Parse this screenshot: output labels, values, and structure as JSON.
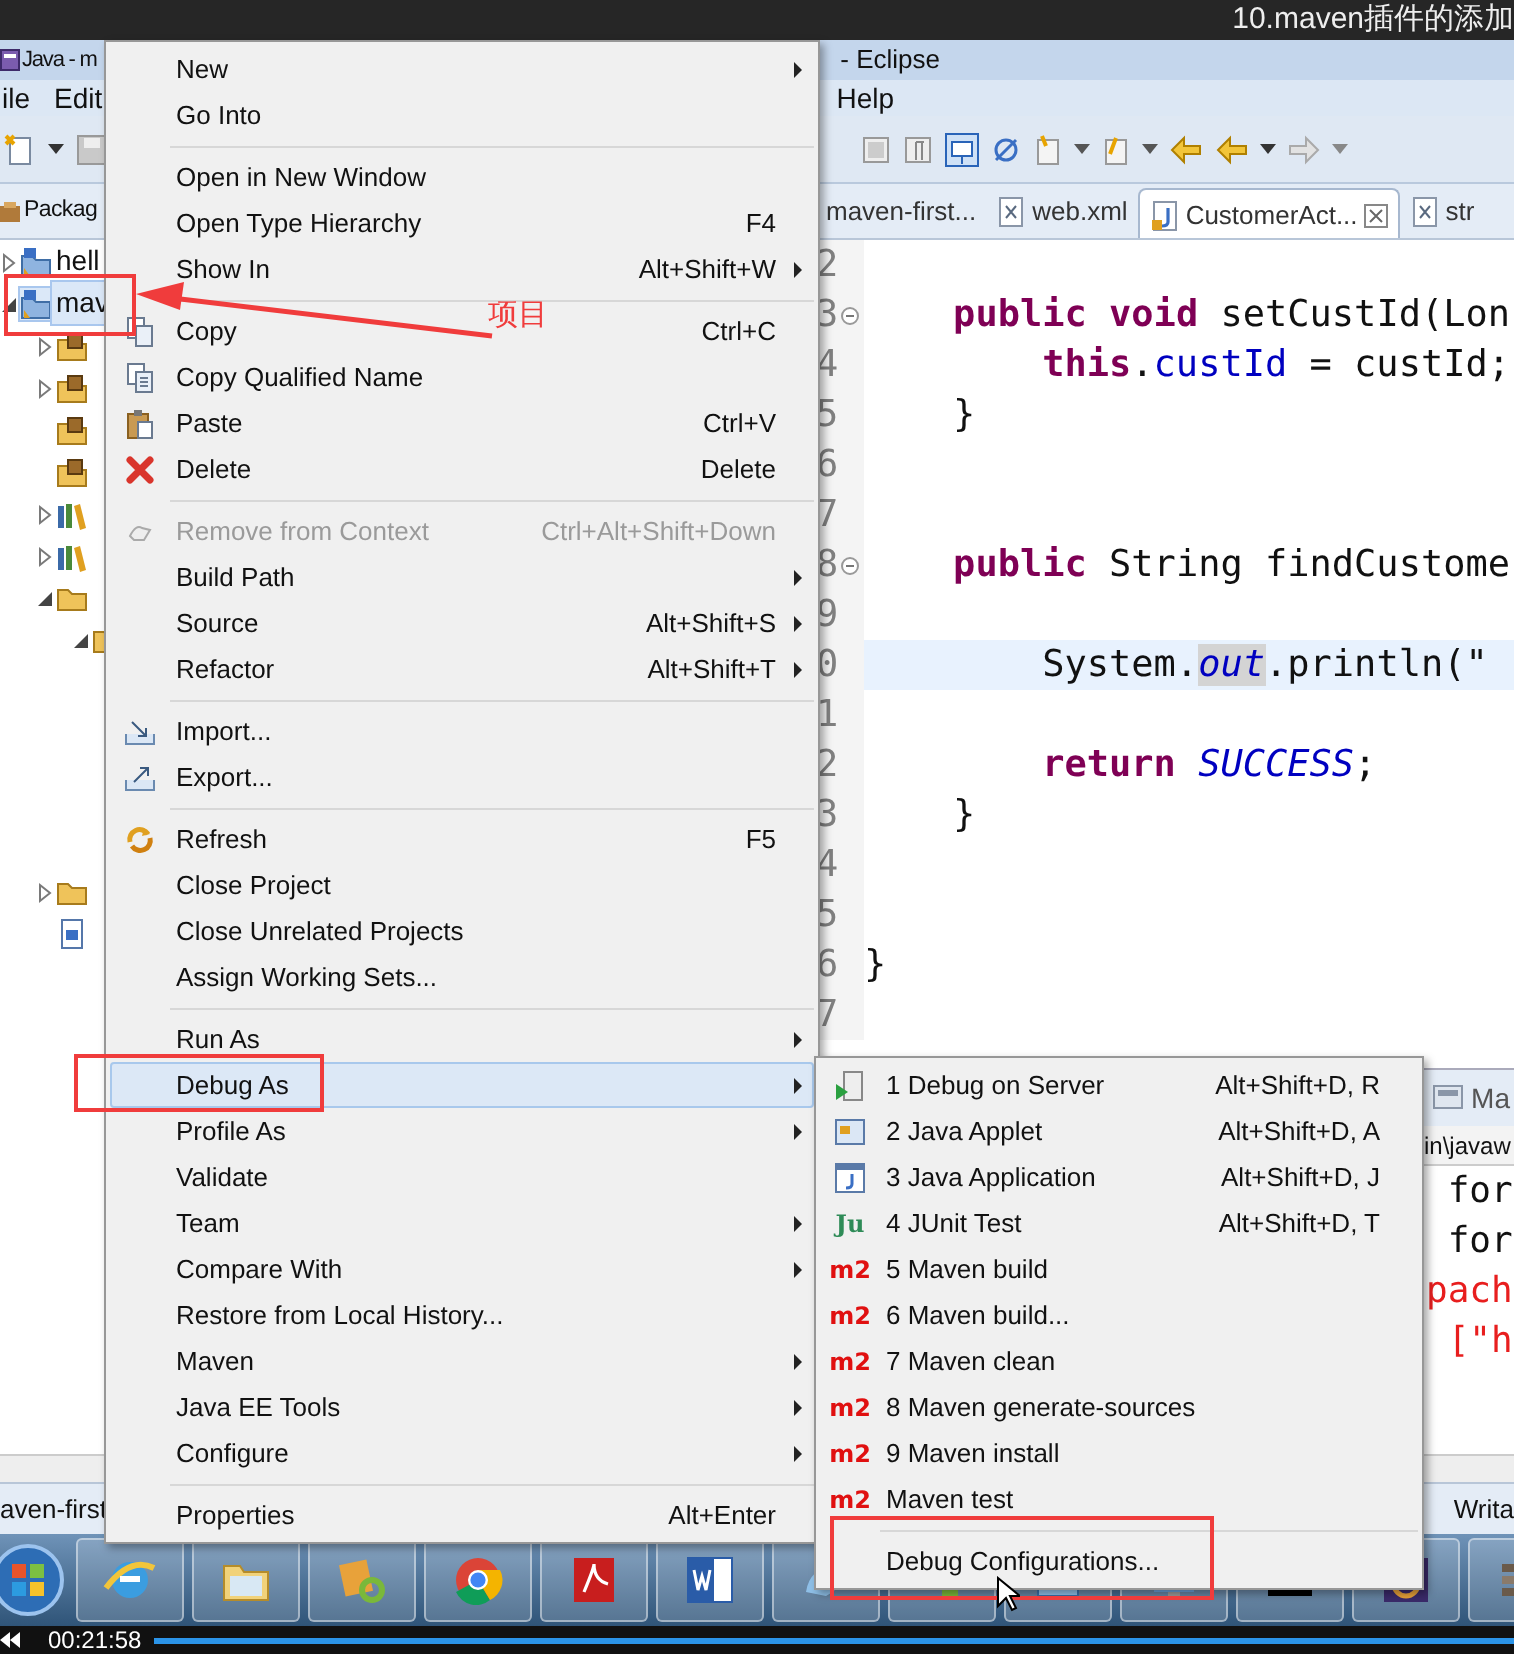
{
  "video_title": "10.maven插件的添加",
  "window": {
    "title": "Java - m",
    "title_suffix": "- Eclipse"
  },
  "menu_bar": [
    "ile",
    "Edit",
    "Help"
  ],
  "package_explorer": {
    "tab": "Packag",
    "tree": [
      {
        "label": "hell",
        "kind": "project",
        "expanded": false,
        "selected": false
      },
      {
        "label": "mav",
        "kind": "project",
        "expanded": true,
        "selected": true,
        "children": [
          {
            "kind": "package",
            "expanded": false,
            "selected": false
          },
          {
            "kind": "package",
            "expanded": false,
            "selected": false
          },
          {
            "kind": "package",
            "selected": false
          },
          {
            "kind": "package",
            "selected": false
          },
          {
            "kind": "library",
            "expanded": false,
            "selected": false
          },
          {
            "kind": "library",
            "expanded": false,
            "selected": false
          },
          {
            "kind": "folder",
            "expanded": true,
            "selected": false,
            "children": [
              {
                "kind": "folder",
                "expanded": true,
                "selected": false
              }
            ]
          },
          {
            "kind": "folder",
            "expanded": false,
            "selected": false
          },
          {
            "kind": "file",
            "selected": false
          }
        ]
      }
    ]
  },
  "editor": {
    "tabs": [
      {
        "label": "maven-first...",
        "kind": "plain",
        "selected": false
      },
      {
        "label": "web.xml",
        "kind": "xml",
        "selected": false
      },
      {
        "label": "CustomerAct...",
        "kind": "java",
        "selected": true
      },
      {
        "label": "str",
        "kind": "xml",
        "selected": false
      }
    ],
    "lines": [
      {
        "number": "2",
        "current": false,
        "foldable": false
      },
      {
        "number": "3",
        "current": false,
        "foldable": true,
        "tokens": [
          {
            "text": "    public",
            "kind": "keyword"
          },
          {
            "text": " void",
            "kind": "keyword"
          },
          {
            "text": " setCustId(Lon",
            "kind": "plain"
          }
        ]
      },
      {
        "number": "4",
        "current": false,
        "foldable": false,
        "tokens": [
          {
            "text": "        this",
            "kind": "keyword"
          },
          {
            "text": ".",
            "kind": "plain"
          },
          {
            "text": "custId",
            "kind": "field"
          },
          {
            "text": " = custId;",
            "kind": "plain"
          }
        ]
      },
      {
        "number": "5",
        "current": false,
        "foldable": false,
        "tokens": [
          {
            "text": "    }",
            "kind": "plain"
          }
        ]
      },
      {
        "number": "6",
        "current": false,
        "foldable": false
      },
      {
        "number": "7",
        "current": false,
        "foldable": false
      },
      {
        "number": "8",
        "current": false,
        "foldable": true,
        "tokens": [
          {
            "text": "    public",
            "kind": "keyword"
          },
          {
            "text": " String findCustome",
            "kind": "plain"
          }
        ]
      },
      {
        "number": "9",
        "current": false,
        "foldable": false
      },
      {
        "number": "0",
        "current": true,
        "foldable": false,
        "tokens": [
          {
            "text": "        System.",
            "kind": "plain"
          },
          {
            "text": "out",
            "kind": "static_mark"
          },
          {
            "text": ".println(\"",
            "kind": "plain"
          }
        ]
      },
      {
        "number": "1",
        "current": false,
        "foldable": false
      },
      {
        "number": "2",
        "current": false,
        "foldable": false,
        "tokens": [
          {
            "text": "        return",
            "kind": "keyword"
          },
          {
            "text": " SUCCESS",
            "kind": "static"
          },
          {
            "text": ";",
            "kind": "plain"
          }
        ]
      },
      {
        "number": "3",
        "current": false,
        "foldable": false,
        "tokens": [
          {
            "text": "    }",
            "kind": "plain"
          }
        ]
      },
      {
        "number": "4",
        "current": false,
        "foldable": false
      },
      {
        "number": "5",
        "current": false,
        "foldable": false
      },
      {
        "number": "6",
        "current": false,
        "foldable": false,
        "tokens": [
          {
            "text": "}",
            "kind": "plain"
          }
        ]
      },
      {
        "number": "7",
        "current": false,
        "foldable": false
      }
    ]
  },
  "console": {
    "tab": "Ma",
    "path": "in\\javaw",
    "lines": [
      {
        "text": " for",
        "kind": "plain"
      },
      {
        "text": " for",
        "kind": "plain"
      },
      {
        "text": "pach",
        "kind": "error"
      },
      {
        "text": " [\"h",
        "kind": "error"
      }
    ]
  },
  "bottom_tabs": {
    "left": "aven-first",
    "right": "Writa"
  },
  "context_menu": {
    "items": [
      {
        "kind": "plain",
        "label": "New",
        "submenu": true,
        "selected": false,
        "disabled": false
      },
      {
        "kind": "plain",
        "label": "Go Into",
        "submenu": false,
        "selected": false,
        "disabled": false
      },
      {
        "kind": "separator"
      },
      {
        "kind": "plain",
        "label": "Open in New Window",
        "submenu": false,
        "selected": false,
        "disabled": false
      },
      {
        "kind": "plain",
        "label": "Open Type Hierarchy",
        "shortcut": "F4",
        "submenu": false,
        "selected": false,
        "disabled": false
      },
      {
        "kind": "plain",
        "label": "Show In",
        "shortcut": "Alt+Shift+W",
        "submenu": true,
        "selected": false,
        "disabled": false
      },
      {
        "kind": "separator"
      },
      {
        "kind": "copy",
        "label": "Copy",
        "shortcut": "Ctrl+C",
        "submenu": false,
        "selected": false,
        "disabled": false
      },
      {
        "kind": "copy_name",
        "label": "Copy Qualified Name",
        "submenu": false,
        "selected": false,
        "disabled": false
      },
      {
        "kind": "paste",
        "label": "Paste",
        "shortcut": "Ctrl+V",
        "submenu": false,
        "selected": false,
        "disabled": false
      },
      {
        "kind": "delete",
        "label": "Delete",
        "shortcut": "Delete",
        "submenu": false,
        "selected": false,
        "disabled": false
      },
      {
        "kind": "separator"
      },
      {
        "kind": "remove",
        "label": "Remove from Context",
        "shortcut": "Ctrl+Alt+Shift+Down",
        "submenu": false,
        "selected": false,
        "disabled": true
      },
      {
        "kind": "plain",
        "label": "Build Path",
        "submenu": true,
        "selected": false,
        "disabled": false
      },
      {
        "kind": "plain",
        "label": "Source",
        "shortcut": "Alt+Shift+S",
        "submenu": true,
        "selected": false,
        "disabled": false
      },
      {
        "kind": "plain",
        "label": "Refactor",
        "shortcut": "Alt+Shift+T",
        "submenu": true,
        "selected": false,
        "disabled": false
      },
      {
        "kind": "separator"
      },
      {
        "kind": "import",
        "label": "Import...",
        "submenu": false,
        "selected": false,
        "disabled": false
      },
      {
        "kind": "export",
        "label": "Export...",
        "submenu": false,
        "selected": false,
        "disabled": false
      },
      {
        "kind": "separator"
      },
      {
        "kind": "refresh",
        "label": "Refresh",
        "shortcut": "F5",
        "submenu": false,
        "selected": false,
        "disabled": false
      },
      {
        "kind": "plain",
        "label": "Close Project",
        "submenu": false,
        "selected": false,
        "disabled": false
      },
      {
        "kind": "plain",
        "label": "Close Unrelated Projects",
        "submenu": false,
        "selected": false,
        "disabled": false
      },
      {
        "kind": "plain",
        "label": "Assign Working Sets...",
        "submenu": false,
        "selected": false,
        "disabled": false
      },
      {
        "kind": "separator"
      },
      {
        "kind": "plain",
        "label": "Run As",
        "submenu": true,
        "selected": false,
        "disabled": false
      },
      {
        "kind": "plain",
        "label": "Debug As",
        "submenu": true,
        "selected": true,
        "disabled": false
      },
      {
        "kind": "plain",
        "label": "Profile As",
        "submenu": true,
        "selected": false,
        "disabled": false
      },
      {
        "kind": "plain",
        "label": "Validate",
        "submenu": false,
        "selected": false,
        "disabled": false
      },
      {
        "kind": "plain",
        "label": "Team",
        "submenu": true,
        "selected": false,
        "disabled": false
      },
      {
        "kind": "plain",
        "label": "Compare With",
        "submenu": true,
        "selected": false,
        "disabled": false
      },
      {
        "kind": "plain",
        "label": "Restore from Local History...",
        "submenu": false,
        "selected": false,
        "disabled": false
      },
      {
        "kind": "plain",
        "label": "Maven",
        "submenu": true,
        "selected": false,
        "disabled": false
      },
      {
        "kind": "plain",
        "label": "Java EE Tools",
        "submenu": true,
        "selected": false,
        "disabled": false
      },
      {
        "kind": "plain",
        "label": "Configure",
        "submenu": true,
        "selected": false,
        "disabled": false
      },
      {
        "kind": "separator"
      },
      {
        "kind": "plain",
        "label": "Properties",
        "shortcut": "Alt+Enter",
        "submenu": false,
        "selected": false,
        "disabled": false
      }
    ]
  },
  "submenu": {
    "items": [
      {
        "kind": "server",
        "label": "1 Debug on Server",
        "shortcut": "Alt+Shift+D, R",
        "selected": false
      },
      {
        "kind": "applet",
        "label": "2 Java Applet",
        "shortcut": "Alt+Shift+D, A",
        "selected": false
      },
      {
        "kind": "application",
        "label": "3 Java Application",
        "shortcut": "Alt+Shift+D, J",
        "selected": false
      },
      {
        "kind": "junit",
        "icon_text": "Ju",
        "label": "4 JUnit Test",
        "shortcut": "Alt+Shift+D, T",
        "selected": false
      },
      {
        "kind": "maven",
        "icon_text": "m2",
        "label": "5 Maven build",
        "selected": false
      },
      {
        "kind": "maven",
        "icon_text": "m2",
        "label": "6 Maven build...",
        "selected": false
      },
      {
        "kind": "maven",
        "icon_text": "m2",
        "label": "7 Maven clean",
        "selected": false
      },
      {
        "kind": "maven",
        "icon_text": "m2",
        "label": "8 Maven generate-sources",
        "selected": false
      },
      {
        "kind": "maven",
        "icon_text": "m2",
        "label": "9 Maven install",
        "selected": false
      },
      {
        "kind": "maven",
        "icon_text": "m2",
        "label": "Maven test",
        "selected": false
      },
      {
        "kind": "separator"
      },
      {
        "kind": "plain",
        "label": "Debug Configurations...",
        "selected": false
      }
    ]
  },
  "annotation": {
    "label": "项目"
  },
  "video_player": {
    "time": "00:21:58"
  }
}
